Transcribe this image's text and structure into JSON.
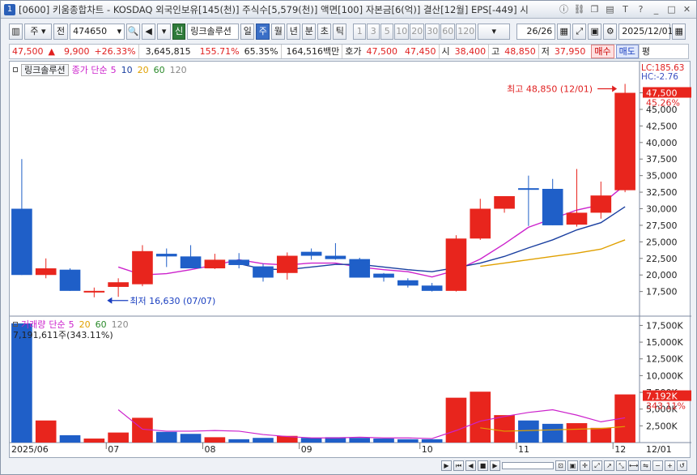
{
  "title": "[0600] 키움종합차트 - KOSDAQ 외국인보유[145(천)] 주식수[5,579(천)] 액면[100] 자본금[6(억)] 결산[12월] EPS[-449] 시",
  "title_icon": "1",
  "toolbar": {
    "mode": "주",
    "prev_label": "전",
    "code": "474650",
    "new_badge": "신",
    "stock_name": "링크솔루션",
    "periods": [
      "일",
      "주",
      "월",
      "년",
      "분",
      "초",
      "틱"
    ],
    "selected_period": "주",
    "intervals": [
      "1",
      "3",
      "5",
      "10",
      "20",
      "30",
      "60",
      "120"
    ],
    "count": "26/26",
    "date": "2025/12/01"
  },
  "quote": {
    "price": "47,500",
    "change_arrow": "▲",
    "change": "9,900",
    "change_pct": "+26.33%",
    "volume": "3,645,815",
    "volume_ratio": "155.71%",
    "turnover": "65.35%",
    "amount": "164,516백만",
    "ask_label": "호가",
    "ask1": "47,500",
    "ask2": "47,450",
    "open_label": "시",
    "open": "38,400",
    "high_label": "고",
    "high": "48,850",
    "low_label": "저",
    "low": "37,950",
    "buy_label": "매수",
    "sell_label": "매도",
    "avg_label": "평"
  },
  "price_panel": {
    "name": "링크솔루션",
    "ma_label": "종가 단순",
    "ma_periods": [
      "5",
      "10",
      "20",
      "60",
      "120"
    ],
    "ma_colors": [
      "#cc22cc",
      "#1a3fa0",
      "#e0a000",
      "#2a8a2a",
      "#888888"
    ],
    "lc_label": "LC:185.63",
    "hc_label": "HC:-2.76",
    "current_price_tag": "47,500",
    "current_pct_tag": "45.26%",
    "high_annotation": "최고 48,850 (12/01)",
    "low_annotation": "최저 16,630 (07/07)"
  },
  "volume_panel": {
    "label": "거래량",
    "ma_label": "단순",
    "ma_periods": [
      "5",
      "20",
      "60",
      "120"
    ],
    "readout": "7,191,611주(343.11%)",
    "current_tag": "7,192K",
    "current_pct_tag": "343.11%"
  },
  "x_axis_labels": [
    "2025/06",
    "07",
    "08",
    "09",
    "10",
    "11",
    "12",
    "12/01"
  ],
  "chart_data": [
    {
      "type": "candlestick",
      "y_ticks": [
        "47,500",
        "45,000",
        "42,500",
        "40,000",
        "37,500",
        "35,000",
        "32,500",
        "30,000",
        "27,500",
        "25,000",
        "22,500",
        "20,000",
        "17,500"
      ],
      "ylim": [
        15500,
        50500
      ],
      "candles": [
        {
          "o": 30000,
          "h": 37500,
          "l": 20000,
          "c": 20000
        },
        {
          "o": 20000,
          "h": 22500,
          "l": 19500,
          "c": 21000
        },
        {
          "o": 20800,
          "h": 21000,
          "l": 17600,
          "c": 17600
        },
        {
          "o": 17400,
          "h": 18100,
          "l": 16630,
          "c": 17600
        },
        {
          "o": 18200,
          "h": 19500,
          "l": 16700,
          "c": 18900
        },
        {
          "o": 18600,
          "h": 24500,
          "l": 18300,
          "c": 23600
        },
        {
          "o": 23200,
          "h": 24000,
          "l": 21200,
          "c": 22800
        },
        {
          "o": 22800,
          "h": 24500,
          "l": 21000,
          "c": 21000
        },
        {
          "o": 21000,
          "h": 23200,
          "l": 20900,
          "c": 22300
        },
        {
          "o": 22300,
          "h": 23300,
          "l": 21000,
          "c": 21500
        },
        {
          "o": 21300,
          "h": 21700,
          "l": 19000,
          "c": 19600
        },
        {
          "o": 20300,
          "h": 23400,
          "l": 19300,
          "c": 22900
        },
        {
          "o": 23500,
          "h": 24000,
          "l": 22300,
          "c": 22900
        },
        {
          "o": 22900,
          "h": 24800,
          "l": 22300,
          "c": 22400
        },
        {
          "o": 22400,
          "h": 22600,
          "l": 19600,
          "c": 19600
        },
        {
          "o": 20200,
          "h": 20300,
          "l": 19000,
          "c": 19600
        },
        {
          "o": 19200,
          "h": 19500,
          "l": 18100,
          "c": 18400
        },
        {
          "o": 18400,
          "h": 18800,
          "l": 17500,
          "c": 17600
        },
        {
          "o": 17600,
          "h": 26000,
          "l": 17500,
          "c": 25500
        },
        {
          "o": 25500,
          "h": 31500,
          "l": 25300,
          "c": 30000
        },
        {
          "o": 30000,
          "h": 31200,
          "l": 29400,
          "c": 31900
        },
        {
          "o": 33100,
          "h": 35000,
          "l": 27400,
          "c": 32900
        },
        {
          "o": 33000,
          "h": 34500,
          "l": 27500,
          "c": 27500
        },
        {
          "o": 27600,
          "h": 36000,
          "l": 27300,
          "c": 29400
        },
        {
          "o": 29400,
          "h": 34100,
          "l": 28500,
          "c": 32000
        },
        {
          "o": 32800,
          "h": 48850,
          "l": 32500,
          "c": 47500
        }
      ],
      "ma_series": [
        {
          "period": "5",
          "values": [
            null,
            null,
            null,
            null,
            21200,
            20000,
            20200,
            20800,
            21500,
            22300,
            21700,
            21500,
            21800,
            21800,
            21200,
            20800,
            20500,
            19700,
            20700,
            22400,
            24700,
            27200,
            28500,
            29800,
            30600,
            33600
          ]
        },
        {
          "period": "10",
          "values": [
            null,
            null,
            null,
            null,
            null,
            null,
            null,
            null,
            null,
            21700,
            20900,
            20800,
            21200,
            21600,
            21600,
            21200,
            20800,
            20500,
            21100,
            21800,
            22800,
            24100,
            25300,
            26800,
            27900,
            30300
          ]
        },
        {
          "period": "20",
          "values": [
            null,
            null,
            null,
            null,
            null,
            null,
            null,
            null,
            null,
            null,
            null,
            null,
            null,
            null,
            null,
            null,
            null,
            null,
            null,
            21300,
            21800,
            22300,
            22800,
            23300,
            23900,
            25300
          ]
        }
      ]
    },
    {
      "type": "bar",
      "y_ticks": [
        "17,500K",
        "15,000K",
        "12,500K",
        "10,000K",
        "7,500K",
        "5,000K",
        "2,500K"
      ],
      "ylim": [
        0,
        18400000
      ],
      "values": [
        17800000,
        3300000,
        1100000,
        600000,
        1500000,
        3700000,
        1600000,
        1300000,
        800000,
        500000,
        700000,
        1000000,
        700000,
        800000,
        700000,
        600000,
        500000,
        500000,
        6700000,
        7600000,
        4100000,
        3300000,
        2800000,
        2900000,
        2200000,
        7192000
      ],
      "ma5": [
        null,
        null,
        null,
        null,
        4900000,
        2000000,
        1700000,
        1700000,
        1800000,
        1700000,
        1200000,
        900000,
        700000,
        700000,
        800000,
        700000,
        700000,
        600000,
        1800000,
        3200000,
        3900000,
        4500000,
        4900000,
        4100000,
        3100000,
        3700000
      ],
      "ma20": [
        null,
        null,
        null,
        null,
        null,
        null,
        null,
        null,
        null,
        null,
        null,
        null,
        null,
        null,
        null,
        null,
        null,
        null,
        null,
        2200000,
        1700000,
        1800000,
        1900000,
        2000000,
        2100000,
        2400000
      ]
    }
  ]
}
